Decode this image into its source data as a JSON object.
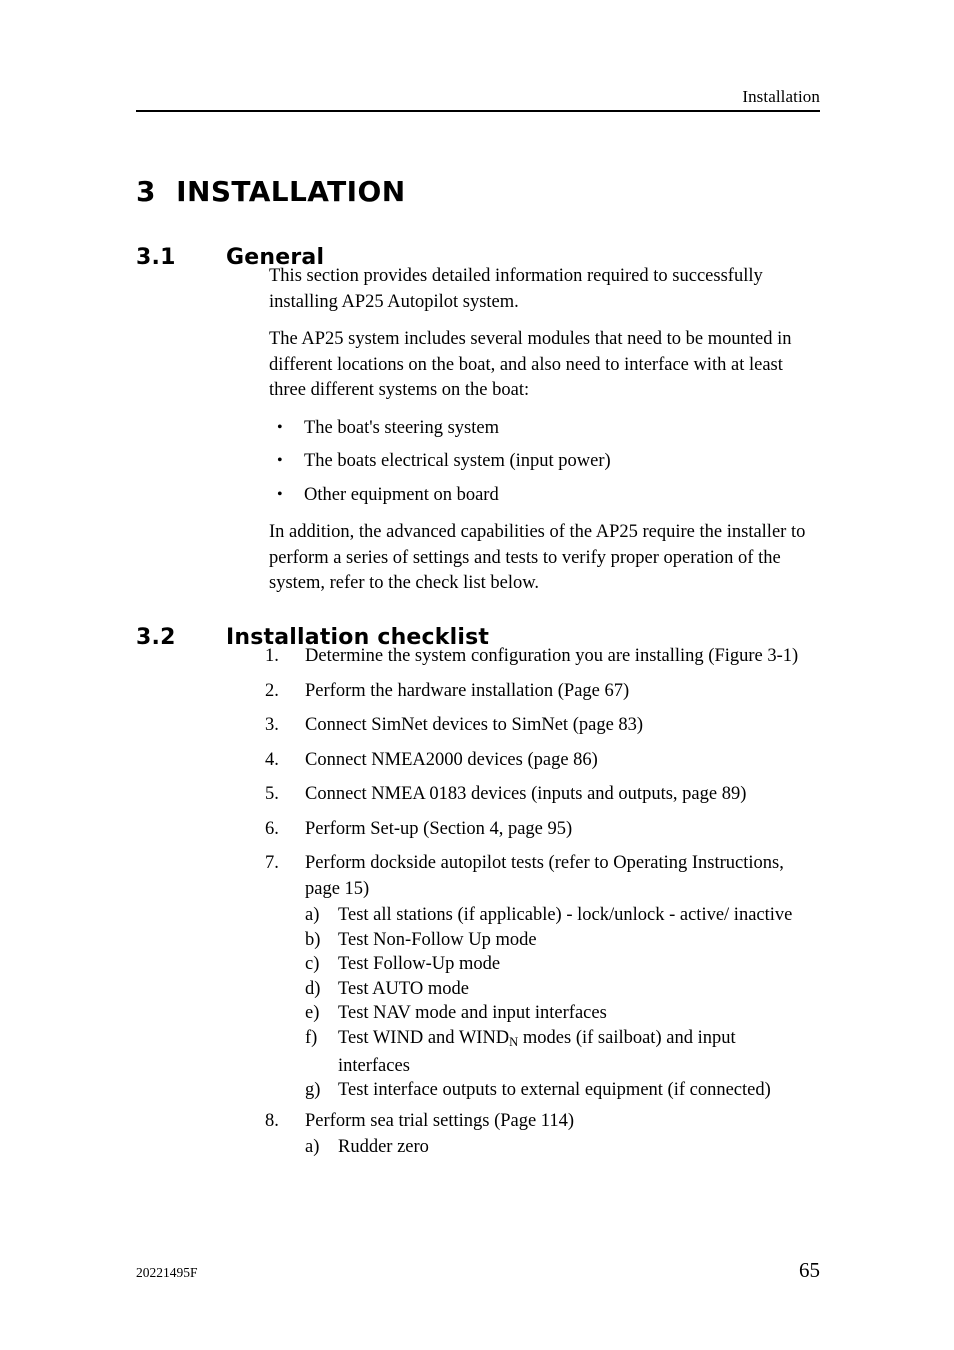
{
  "header": {
    "running_title": "Installation"
  },
  "chapter": {
    "number": "3",
    "title": "INSTALLATION",
    "full": "3  INSTALLATION"
  },
  "sections": [
    {
      "number": "3.1",
      "title": "General",
      "paragraphs": [
        "This section provides detailed information required to successfully installing AP25 Autopilot system.",
        "The AP25 system includes several modules that need to be mounted in different locations on the boat, and also need to interface with at least three different systems on the boat:"
      ],
      "bullets": [
        "The boat's steering system",
        "The boats electrical system (input power)",
        "Other equipment on board"
      ],
      "closing_paragraph": "In addition, the advanced capabilities of the AP25 require the installer to perform a series of settings and tests to verify proper operation of the system, refer to the check list below."
    },
    {
      "number": "3.2",
      "title": "Installation checklist"
    }
  ],
  "checklist": [
    {
      "marker": "1.",
      "text": "Determine the system configuration you are installing (Figure 3-1)"
    },
    {
      "marker": "2.",
      "text": "Perform the hardware installation (Page 67)"
    },
    {
      "marker": "3.",
      "text": "Connect SimNet devices to SimNet (page 83)"
    },
    {
      "marker": "4.",
      "text": "Connect NMEA2000 devices (page 86)"
    },
    {
      "marker": "5.",
      "text": "Connect NMEA 0183 devices (inputs and outputs, page 89)"
    },
    {
      "marker": "6.",
      "text": "Perform Set-up (Section 4, page 95)"
    },
    {
      "marker": "7.",
      "text": "Perform dockside autopilot tests (refer to Operating Instructions, page 15)"
    },
    {
      "marker": "8.",
      "text": "Perform sea trial settings (Page 114)"
    }
  ],
  "dockside_subitems": [
    {
      "marker": "a)",
      "text": "Test all stations (if applicable) - lock/unlock - active/ inactive"
    },
    {
      "marker": "b)",
      "text": "Test Non-Follow Up mode"
    },
    {
      "marker": "c)",
      "text": "Test Follow-Up mode"
    },
    {
      "marker": "d)",
      "text": "Test AUTO mode"
    },
    {
      "marker": "e)",
      "text": "Test NAV mode and input interfaces"
    },
    {
      "marker": "f)",
      "text_before": "Test WIND and WIND",
      "subscript": "N",
      "text_after": " modes (if sailboat) and input interfaces"
    },
    {
      "marker": "g)",
      "text": "Test interface outputs to external equipment (if connected)"
    }
  ],
  "sea_trial_subitems": [
    {
      "marker": "a)",
      "text": "Rudder zero"
    }
  ],
  "footer": {
    "document_id": "20221495F",
    "page_number": "65"
  }
}
